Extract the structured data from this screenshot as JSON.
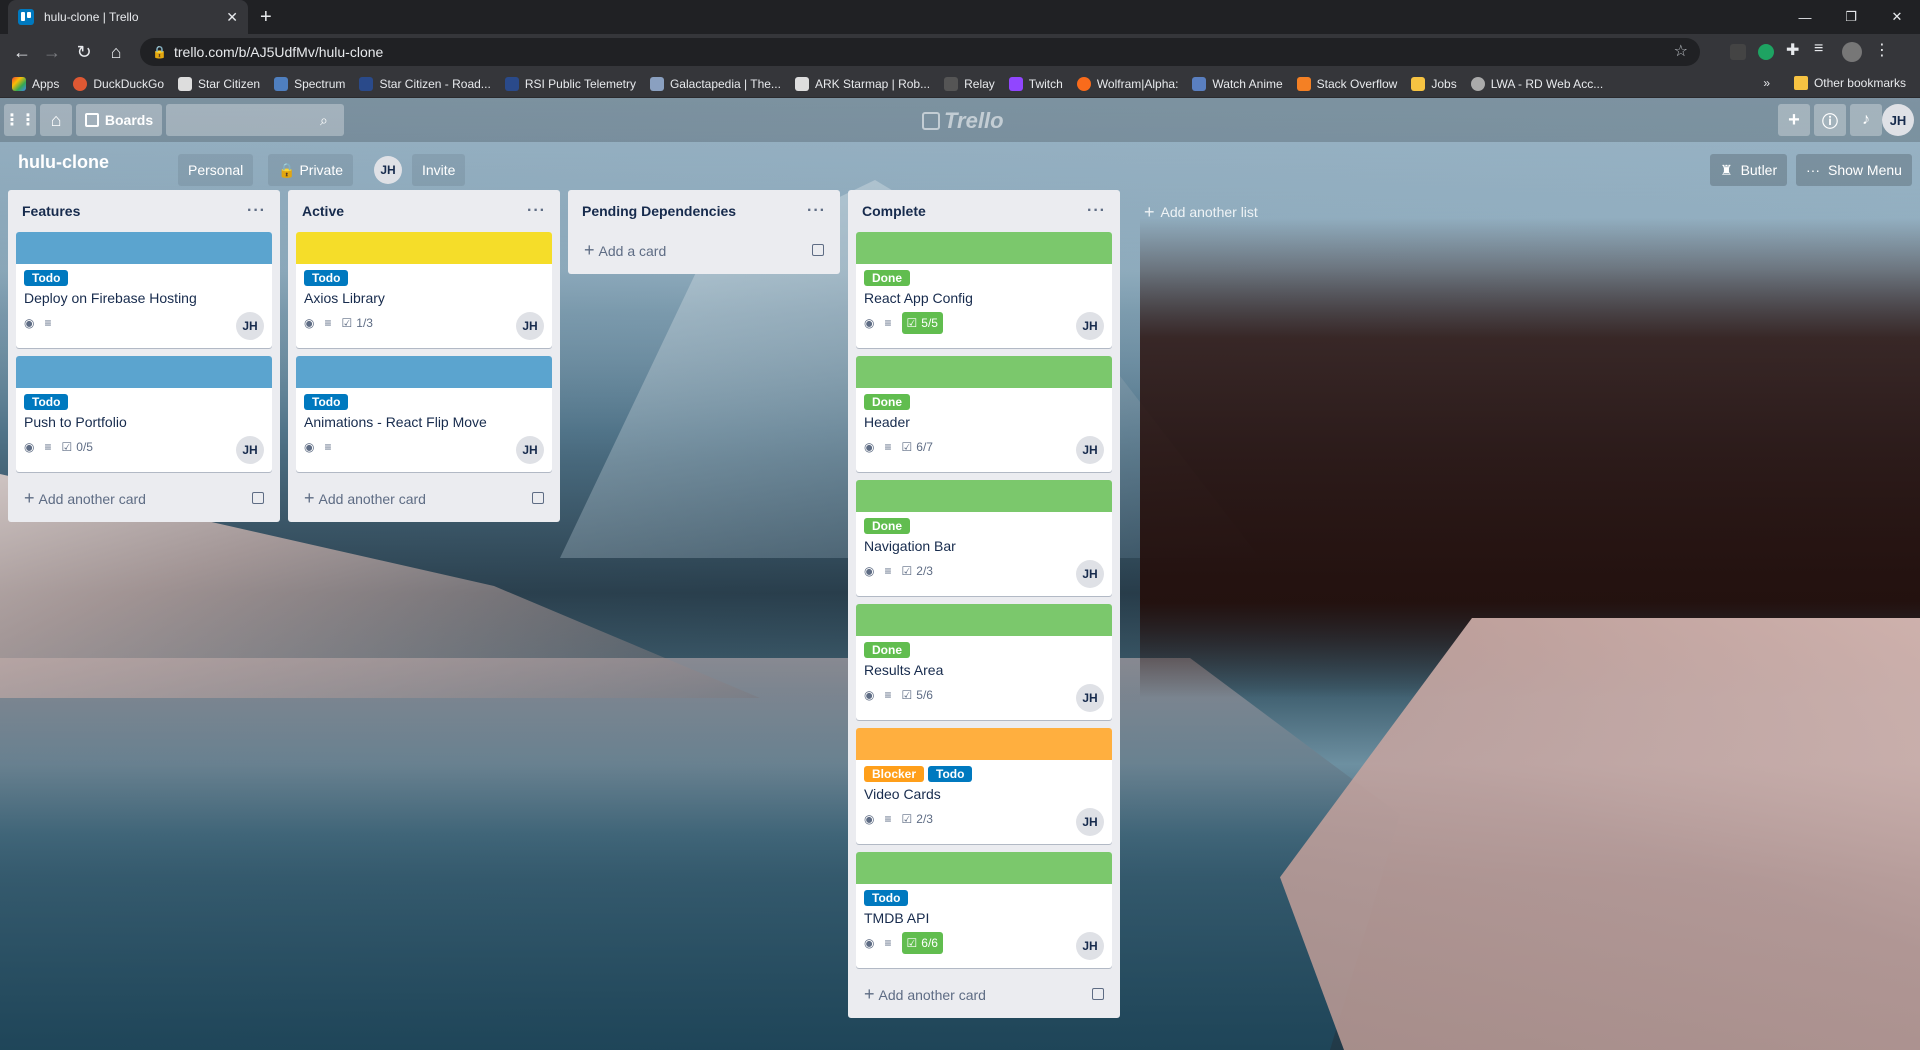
{
  "browser": {
    "tab_title": "hulu-clone | Trello",
    "url": "trello.com/b/AJ5UdfMv/hulu-clone",
    "bookmarks": [
      "Apps",
      "DuckDuckGo",
      "Star Citizen",
      "Spectrum",
      "Star Citizen - Road...",
      "RSI Public Telemetry",
      "Galactapedia | The...",
      "ARK Starmap | Rob...",
      "Relay",
      "Twitch",
      "Wolfram|Alpha:",
      "Watch Anime",
      "Stack Overflow",
      "Jobs",
      "LWA - RD Web Acc..."
    ],
    "other_bookmarks": "Other bookmarks",
    "more": "»"
  },
  "trello": {
    "boards_label": "Boards",
    "logo": "Trello",
    "user_initials": "JH"
  },
  "board": {
    "title": "hulu-clone",
    "team": "Personal",
    "visibility": "Private",
    "member_initials": "JH",
    "invite": "Invite",
    "butler": "Butler",
    "show_menu": "Show Menu",
    "add_list": "Add another list"
  },
  "colors": {
    "blue": "#5ba4cf",
    "yellow": "#f5dd29",
    "green": "#7bc86c",
    "orange": "#ffaf3f",
    "label_todo": "#0079bf",
    "label_done": "#61bd4f",
    "label_blocker": "#ff9f1a"
  },
  "lists": [
    {
      "title": "Features",
      "add_label": "Add another card",
      "cards": [
        {
          "cover": "blue",
          "labels": [
            {
              "text": "Todo",
              "color": "label_todo"
            }
          ],
          "title": "Deploy on Firebase Hosting",
          "checklist": "",
          "checklist_done": false
        },
        {
          "cover": "blue",
          "labels": [
            {
              "text": "Todo",
              "color": "label_todo"
            }
          ],
          "title": "Push to Portfolio",
          "checklist": "0/5",
          "checklist_done": false
        }
      ]
    },
    {
      "title": "Active",
      "add_label": "Add another card",
      "cards": [
        {
          "cover": "yellow",
          "labels": [
            {
              "text": "Todo",
              "color": "label_todo"
            }
          ],
          "title": "Axios Library",
          "checklist": "1/3",
          "checklist_done": false
        },
        {
          "cover": "blue",
          "labels": [
            {
              "text": "Todo",
              "color": "label_todo"
            }
          ],
          "title": "Animations - React Flip Move",
          "checklist": "",
          "checklist_done": false
        }
      ]
    },
    {
      "title": "Pending Dependencies",
      "add_label": "Add a card",
      "cards": []
    },
    {
      "title": "Complete",
      "add_label": "Add another card",
      "cards": [
        {
          "cover": "green",
          "labels": [
            {
              "text": "Done",
              "color": "label_done"
            }
          ],
          "title": "React App Config",
          "checklist": "5/5",
          "checklist_done": true
        },
        {
          "cover": "green",
          "labels": [
            {
              "text": "Done",
              "color": "label_done"
            }
          ],
          "title": "Header",
          "checklist": "6/7",
          "checklist_done": false
        },
        {
          "cover": "green",
          "labels": [
            {
              "text": "Done",
              "color": "label_done"
            }
          ],
          "title": "Navigation Bar",
          "checklist": "2/3",
          "checklist_done": false
        },
        {
          "cover": "green",
          "labels": [
            {
              "text": "Done",
              "color": "label_done"
            }
          ],
          "title": "Results Area",
          "checklist": "5/6",
          "checklist_done": false
        },
        {
          "cover": "orange",
          "labels": [
            {
              "text": "Blocker",
              "color": "label_blocker"
            },
            {
              "text": "Todo",
              "color": "label_todo"
            }
          ],
          "title": "Video Cards",
          "checklist": "2/3",
          "checklist_done": false
        },
        {
          "cover": "green",
          "labels": [
            {
              "text": "Todo",
              "color": "label_todo"
            }
          ],
          "title": "TMDB API",
          "checklist": "6/6",
          "checklist_done": true
        }
      ]
    }
  ]
}
